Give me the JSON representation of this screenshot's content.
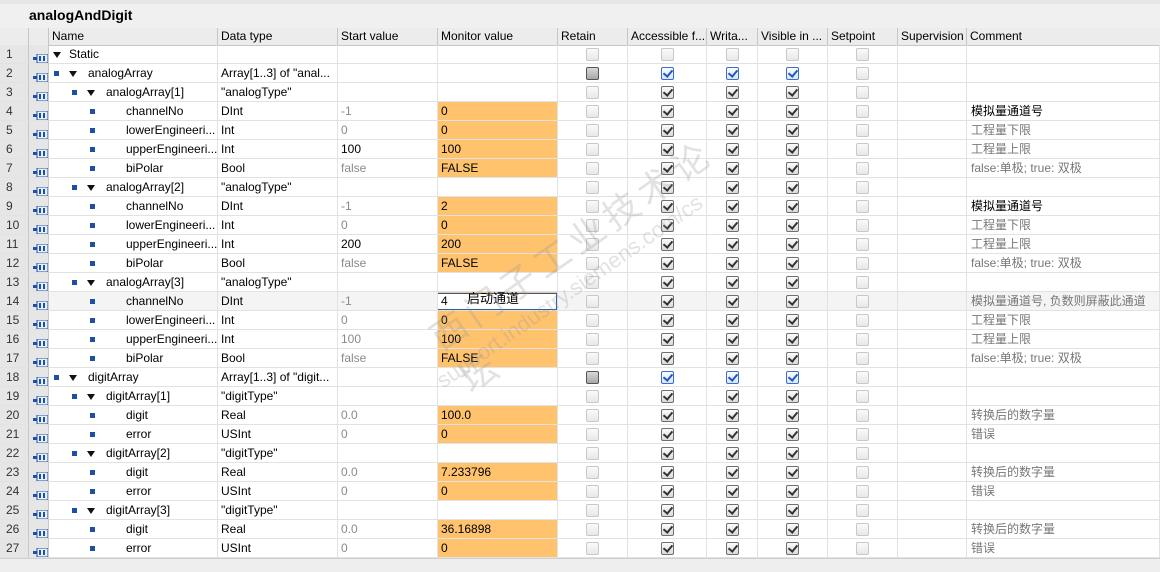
{
  "block_title": "analogAndDigit",
  "columns": {
    "name": "Name",
    "datatype": "Data type",
    "start": "Start value",
    "monitor": "Monitor value",
    "retain": "Retain",
    "accessible": "Accessible f...",
    "writable": "Writa...",
    "visible": "Visible in ...",
    "setpoint": "Setpoint",
    "supervision": "Supervision",
    "comment": "Comment"
  },
  "rows": [
    {
      "n": "1",
      "name": "Static",
      "type": "",
      "start": "",
      "mon": "",
      "comment": ""
    },
    {
      "n": "2",
      "name": "analogArray",
      "type": "Array[1..3] of \"anal...",
      "start": "",
      "mon": "",
      "comment": ""
    },
    {
      "n": "3",
      "name": "analogArray[1]",
      "type": "\"analogType\"",
      "start": "",
      "mon": "",
      "comment": ""
    },
    {
      "n": "4",
      "name": "channelNo",
      "type": "DInt",
      "start": "-1",
      "mon": "0",
      "comment": "模拟量通道号"
    },
    {
      "n": "5",
      "name": "lowerEngineeri...",
      "type": "Int",
      "start": "0",
      "mon": "0",
      "comment": "工程量下限"
    },
    {
      "n": "6",
      "name": "upperEngineeri...",
      "type": "Int",
      "start": "100",
      "mon": "100",
      "comment": "工程量上限"
    },
    {
      "n": "7",
      "name": "biPolar",
      "type": "Bool",
      "start": "false",
      "mon": "FALSE",
      "comment": "false:单极; true: 双极"
    },
    {
      "n": "8",
      "name": "analogArray[2]",
      "type": "\"analogType\"",
      "start": "",
      "mon": "",
      "comment": ""
    },
    {
      "n": "9",
      "name": "channelNo",
      "type": "DInt",
      "start": "-1",
      "mon": "2",
      "comment": "模拟量通道号"
    },
    {
      "n": "10",
      "name": "lowerEngineeri...",
      "type": "Int",
      "start": "0",
      "mon": "0",
      "comment": "工程量下限"
    },
    {
      "n": "11",
      "name": "upperEngineeri...",
      "type": "Int",
      "start": "200",
      "mon": "200",
      "comment": "工程量上限"
    },
    {
      "n": "12",
      "name": "biPolar",
      "type": "Bool",
      "start": "false",
      "mon": "FALSE",
      "comment": "false:单极; true: 双极"
    },
    {
      "n": "13",
      "name": "analogArray[3]",
      "type": "\"analogType\"",
      "start": "",
      "mon": "",
      "comment": ""
    },
    {
      "n": "14",
      "name": "channelNo",
      "type": "DInt",
      "start": "-1",
      "mon": "4",
      "comment": "模拟量通道号, 负数则屏蔽此通道"
    },
    {
      "n": "15",
      "name": "lowerEngineeri...",
      "type": "Int",
      "start": "0",
      "mon": "0",
      "comment": "工程量下限"
    },
    {
      "n": "16",
      "name": "upperEngineeri...",
      "type": "Int",
      "start": "100",
      "mon": "100",
      "comment": "工程量上限"
    },
    {
      "n": "17",
      "name": "biPolar",
      "type": "Bool",
      "start": "false",
      "mon": "FALSE",
      "comment": "false:单极; true: 双极"
    },
    {
      "n": "18",
      "name": "digitArray",
      "type": "Array[1..3] of \"digit...",
      "start": "",
      "mon": "",
      "comment": ""
    },
    {
      "n": "19",
      "name": "digitArray[1]",
      "type": "\"digitType\"",
      "start": "",
      "mon": "",
      "comment": ""
    },
    {
      "n": "20",
      "name": "digit",
      "type": "Real",
      "start": "0.0",
      "mon": "100.0",
      "comment": "转换后的数字量"
    },
    {
      "n": "21",
      "name": "error",
      "type": "USInt",
      "start": "0",
      "mon": "0",
      "comment": "错误"
    },
    {
      "n": "22",
      "name": "digitArray[2]",
      "type": "\"digitType\"",
      "start": "",
      "mon": "",
      "comment": ""
    },
    {
      "n": "23",
      "name": "digit",
      "type": "Real",
      "start": "0.0",
      "mon": "7.233796",
      "comment": "转换后的数字量"
    },
    {
      "n": "24",
      "name": "error",
      "type": "USInt",
      "start": "0",
      "mon": "0",
      "comment": "错误"
    },
    {
      "n": "25",
      "name": "digitArray[3]",
      "type": "\"digitType\"",
      "start": "",
      "mon": "",
      "comment": ""
    },
    {
      "n": "26",
      "name": "digit",
      "type": "Real",
      "start": "0.0",
      "mon": "36.16898",
      "comment": "转换后的数字量"
    },
    {
      "n": "27",
      "name": "error",
      "type": "USInt",
      "start": "0",
      "mon": "0",
      "comment": "错误"
    }
  ],
  "edit_tooltip": "启动通道",
  "watermark": {
    "line1": "西门子工业技术论坛",
    "line2": "support.industry.siemens.com/cs"
  },
  "colors": {
    "monitor_highlight": "#ffc36e",
    "header_bg": "#ececec",
    "icon_blue": "#1f4fa5"
  }
}
